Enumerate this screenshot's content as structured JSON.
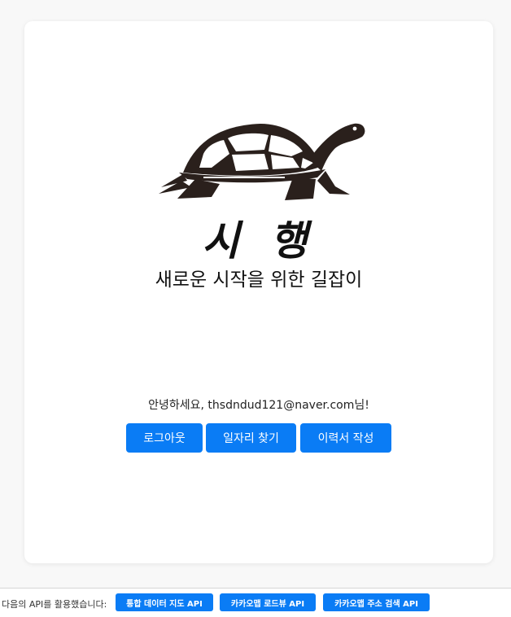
{
  "brand": {
    "title": "시 행",
    "subtitle": "새로운 시작을 위한 길잡이",
    "logo_icon": "turtle-icon",
    "accent_color": "#0a7cf5"
  },
  "user": {
    "greeting": "안녕하세요, thsdndud121@naver.com님!"
  },
  "actions": {
    "logout": "로그아웃",
    "find_jobs": "일자리 찾기",
    "write_resume": "이력서 작성"
  },
  "footer": {
    "label": "다음의 API를 활용했습니다:",
    "apis": [
      "통합 데이터 지도 API",
      "카카오맵 로드뷰 API",
      "카카오맵 주소 검색 API"
    ]
  }
}
